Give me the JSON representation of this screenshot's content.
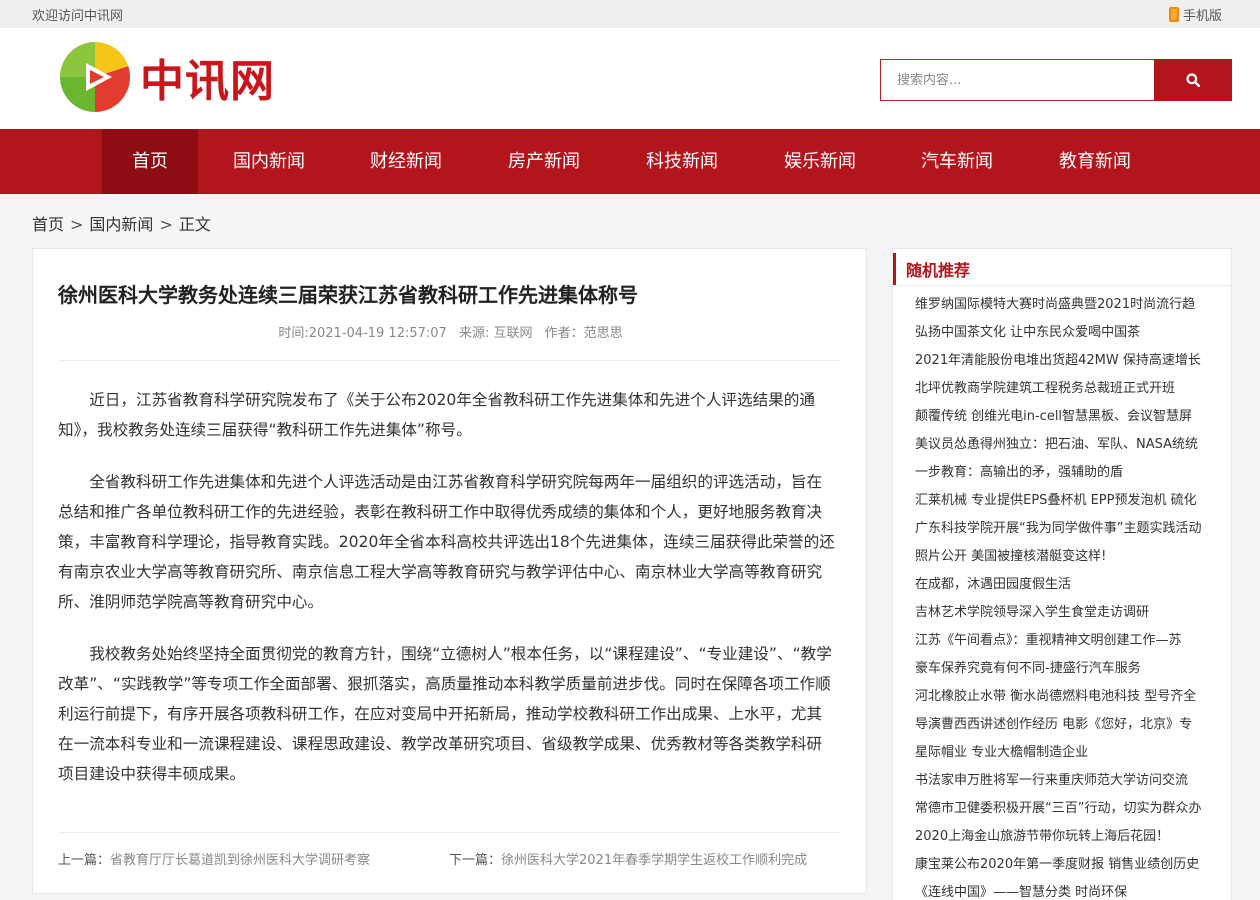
{
  "topbar": {
    "welcome": "欢迎访问中讯网",
    "mobile_label": "手机版"
  },
  "header": {
    "logo_text": "中讯网",
    "search_placeholder": "搜索内容..."
  },
  "nav": {
    "items": [
      {
        "label": "首页",
        "active": true
      },
      {
        "label": "国内新闻"
      },
      {
        "label": "财经新闻"
      },
      {
        "label": "房产新闻"
      },
      {
        "label": "科技新闻"
      },
      {
        "label": "娱乐新闻"
      },
      {
        "label": "汽车新闻"
      },
      {
        "label": "教育新闻"
      }
    ]
  },
  "breadcrumb": {
    "home": "首页",
    "sep": ">",
    "category": "国内新闻",
    "current": "正文"
  },
  "article": {
    "title": "徐州医科大学教务处连续三届荣获江苏省教科研工作先进集体称号",
    "time": "时间:2021-04-19 12:57:07",
    "source": "来源: 互联网",
    "author": "作者：范思思",
    "paragraphs": [
      "近日，江苏省教育科学研究院发布了《关于公布2020年全省教科研工作先进集体和先进个人评选结果的通知》，我校教务处连续三届获得“教科研工作先进集体”称号。",
      "全省教科研工作先进集体和先进个人评选活动是由江苏省教育科学研究院每两年一届组织的评选活动，旨在总结和推广各单位教科研工作的先进经验，表彰在教科研工作中取得优秀成绩的集体和个人，更好地服务教育决策，丰富教育科学理论，指导教育实践。2020年全省本科高校共评选出18个先进集体，连续三届获得此荣誉的还有南京农业大学高等教育研究所、南京信息工程大学高等教育研究与教学评估中心、南京林业大学高等教育研究所、淮阴师范学院高等教育研究中心。",
      "我校教务处始终坚持全面贯彻党的教育方针，围绕“立德树人”根本任务，以“课程建设”、“专业建设”、“教学改革”、“实践教学”等专项工作全面部署、狠抓落实，高质量推动本科教学质量前进步伐。同时在保障各项工作顺利运行前提下，有序开展各项教科研工作，在应对变局中开拓新局，推动学校教科研工作出成果、上水平，尤其在一流本科专业和一流课程建设、课程思政建设、教学改革研究项目、省级教学成果、优秀教材等各类教学科研项目建设中获得丰硕成果。"
    ],
    "prev_label": "上一篇：",
    "prev_title": "省教育厅厅长葛道凯到徐州医科大学调研考察",
    "next_label": "下一篇：",
    "next_title": "徐州医科大学2021年春季学期学生返校工作顺利完成"
  },
  "sidebar": {
    "title": "随机推荐",
    "items": [
      "维罗纳国际模特大赛时尚盛典暨2021时尚流行趋",
      "弘扬中国茶文化 让中东民众爱喝中国茶",
      "2021年清能股份电堆出货超42MW 保持高速增长",
      "北坪优教商学院建筑工程税务总裁班正式开班",
      "颠覆传统 创维光电in-cell智慧黑板、会议智慧屏",
      "美议员怂恿得州独立：把石油、军队、NASA统统",
      "一步教育：高输出的矛，强辅助的盾",
      "汇莱机械 专业提供EPS叠杯机 EPP预发泡机 硫化",
      "广东科技学院开展“我为同学做件事”主题实践活动",
      "照片公开 美国被撞核潜艇变这样!",
      "在成都，沐遇田园度假生活",
      "吉林艺术学院领导深入学生食堂走访调研",
      "江苏《午间看点》：重视精神文明创建工作—苏",
      "豪车保养究竟有何不同-捷盛行汽车服务",
      "河北橡胶止水带 衡水尚德燃料电池科技 型号齐全",
      "导演曹西西讲述创作经历 电影《您好，北京》专",
      "星际帽业 专业大檐帽制造企业",
      "书法家申万胜将军一行来重庆师范大学访问交流",
      "常德市卫健委积极开展“三百”行动，切实为群众办",
      "2020上海金山旅游节带你玩转上海后花园！",
      "康宝莱公布2020年第一季度财报 销售业绩创历史",
      "《连线中国》——智慧分类 时尚环保"
    ]
  },
  "colors": {
    "brand_red": "#b3151c",
    "nav_active": "#8e0d12"
  },
  "icons": {
    "search": "search-icon",
    "mobile": "phone-icon",
    "logo": "play-logo-icon"
  }
}
